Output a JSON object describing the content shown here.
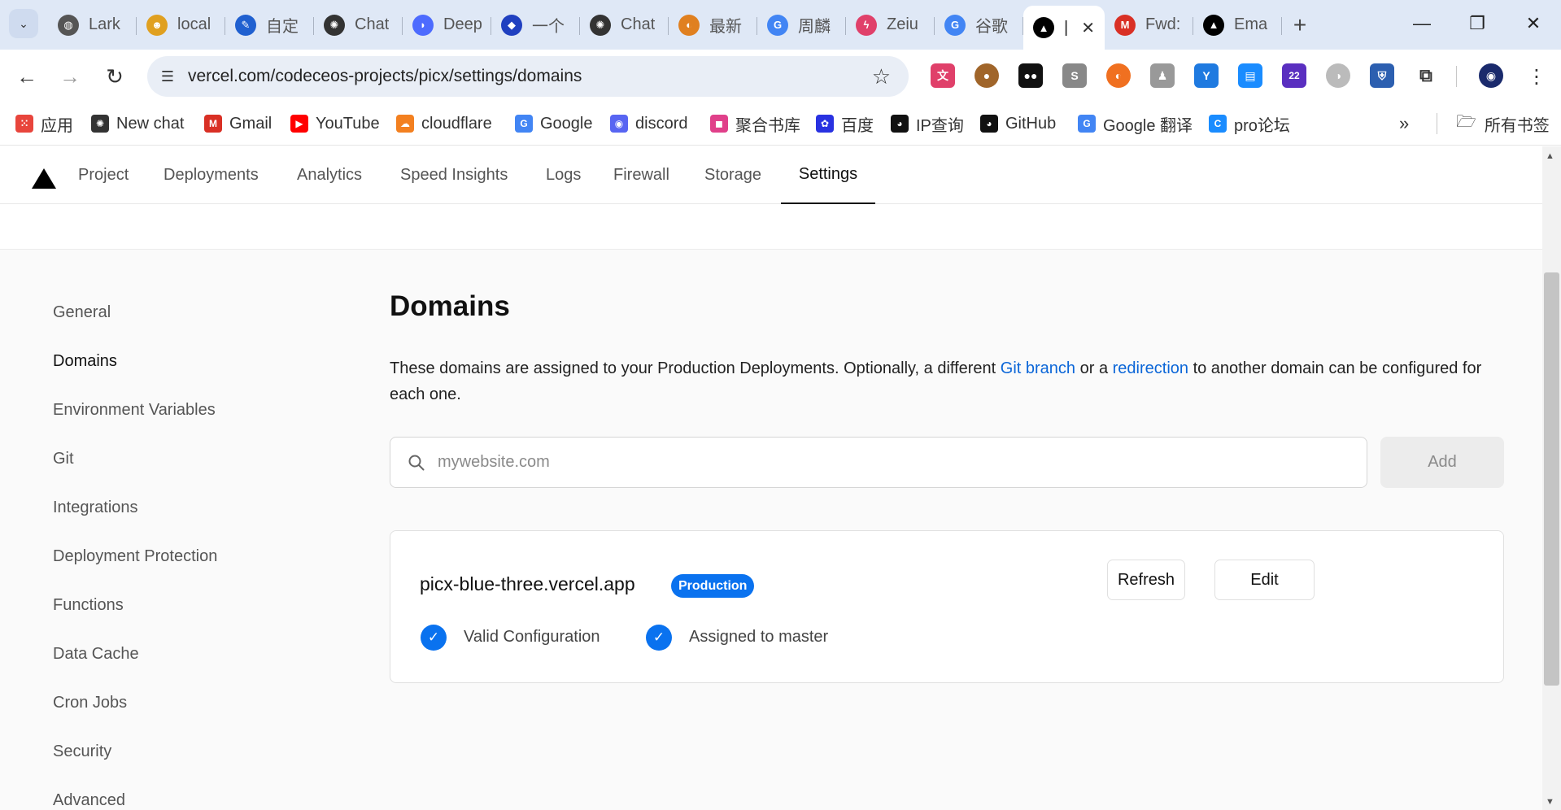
{
  "browser": {
    "tabs": [
      {
        "label": "Lark",
        "icon": "globe-icon",
        "color": "#555555"
      },
      {
        "label": "local",
        "icon": "cat-icon",
        "color": "#e0a020"
      },
      {
        "label": "自定",
        "icon": "feather-icon",
        "color": "#2060d0"
      },
      {
        "label": "Chat",
        "icon": "openai-icon",
        "color": "#333333"
      },
      {
        "label": "Deep",
        "icon": "whale-icon",
        "color": "#4d6bfe"
      },
      {
        "label": "一个",
        "icon": "app-icon",
        "color": "#2040c0"
      },
      {
        "label": "Chat",
        "icon": "openai-icon",
        "color": "#333333"
      },
      {
        "label": "最新",
        "icon": "circle-icon",
        "color": "#e08020"
      },
      {
        "label": "周麟",
        "icon": "google-icon",
        "color": "#4285f4"
      },
      {
        "label": "Zeiu",
        "icon": "bolt-icon",
        "color": "#e0406a"
      },
      {
        "label": "谷歌",
        "icon": "google-icon",
        "color": "#4285f4"
      },
      {
        "label": "|",
        "icon": "vercel-icon",
        "color": "#000000",
        "active": true
      },
      {
        "label": "Fwd:",
        "icon": "gmail-icon",
        "color": "#d93025"
      },
      {
        "label": "Ema",
        "icon": "vercel-icon",
        "color": "#000000"
      }
    ],
    "url": "vercel.com/codeceos-projects/picx/settings/domains",
    "bookmarks": [
      {
        "label": "应用",
        "icon": "apps-grid-icon",
        "color": "#e8453c"
      },
      {
        "label": "New chat",
        "icon": "openai-icon",
        "color": "#333333"
      },
      {
        "label": "Gmail",
        "icon": "gmail-icon",
        "color": "#d93025"
      },
      {
        "label": "YouTube",
        "icon": "youtube-icon",
        "color": "#ff0000"
      },
      {
        "label": "cloudflare",
        "icon": "cloudflare-icon",
        "color": "#f38020"
      },
      {
        "label": "Google",
        "icon": "google-icon",
        "color": "#4285f4"
      },
      {
        "label": "discord",
        "icon": "discord-icon",
        "color": "#5865f2"
      },
      {
        "label": "聚合书库",
        "icon": "book-icon",
        "color": "#e0408a"
      },
      {
        "label": "百度",
        "icon": "baidu-icon",
        "color": "#2932e1"
      },
      {
        "label": "IP查询",
        "icon": "github-icon",
        "color": "#111111"
      },
      {
        "label": "GitHub",
        "icon": "github-icon",
        "color": "#111111"
      },
      {
        "label": "Google 翻译",
        "icon": "translate-icon",
        "color": "#4285f4"
      },
      {
        "label": "pro论坛",
        "icon": "c-icon",
        "color": "#1a8cff"
      }
    ],
    "all_bookmarks_label": "所有书签",
    "extension_badge": "22"
  },
  "project_nav": {
    "tabs": [
      "Project",
      "Deployments",
      "Analytics",
      "Speed Insights",
      "Logs",
      "Firewall",
      "Storage",
      "Settings"
    ],
    "active": "Settings"
  },
  "sidebar": {
    "items": [
      "General",
      "Domains",
      "Environment Variables",
      "Git",
      "Integrations",
      "Deployment Protection",
      "Functions",
      "Data Cache",
      "Cron Jobs",
      "Security",
      "Advanced"
    ],
    "active": "Domains"
  },
  "main": {
    "title": "Domains",
    "desc_part1": "These domains are assigned to your Production Deployments. Optionally, a different ",
    "desc_link1": "Git branch",
    "desc_part2": " or a ",
    "desc_link2": "redirection",
    "desc_part3": " to another domain can be configured for each one.",
    "input_placeholder": "mywebsite.com",
    "input_value": "",
    "add_label": "Add",
    "domain": {
      "name": "picx-blue-three.vercel.app",
      "badge": "Production",
      "refresh_label": "Refresh",
      "edit_label": "Edit",
      "status1": "Valid Configuration",
      "status2": "Assigned to master"
    }
  },
  "colors": {
    "accent": "#0a72ef",
    "link": "#0b66d8"
  }
}
